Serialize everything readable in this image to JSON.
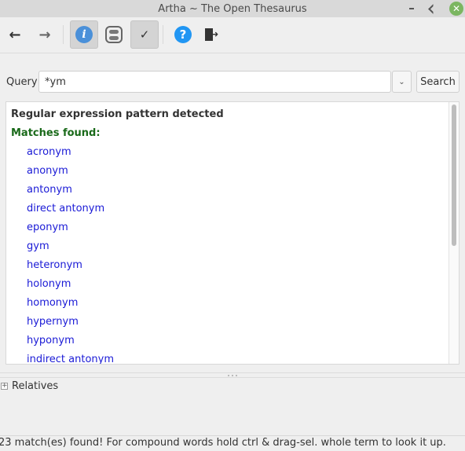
{
  "window": {
    "title": "Artha ~ The Open Thesaurus"
  },
  "toolbar": {
    "back_icon": "arrow-left-icon",
    "forward_icon": "arrow-right-icon",
    "info_icon": "info-icon",
    "info_glyph": "i",
    "toggle_icon": "toggle-switch-icon",
    "check_glyph": "✓",
    "help_glyph": "?",
    "quit_icon": "exit-door-icon",
    "back_glyph": "←",
    "forward_glyph": "→"
  },
  "query": {
    "label": "Query",
    "value": "*ym",
    "dropdown_glyph": "⌄",
    "search_label": "Search"
  },
  "results": {
    "heading": "Regular expression pattern detected",
    "matches_label": "Matches found:",
    "items": [
      "acronym",
      "anonym",
      "antonym",
      "direct antonym",
      "eponym",
      "gym",
      "heteronym",
      "holonym",
      "homonym",
      "hypernym",
      "hyponym",
      "indirect antonym"
    ]
  },
  "relatives": {
    "expander_glyph": "+",
    "label": "Relatives"
  },
  "status": {
    "text": "23 match(es) found! For compound words hold ctrl & drag-sel. whole term to look it up."
  },
  "colors": {
    "heading": "#333333",
    "matches_label": "#1a6a1a",
    "match_link": "#1a1ad6",
    "info_blue": "#4a90d9",
    "help_blue": "#2196f3",
    "close_green": "#7bb661"
  }
}
